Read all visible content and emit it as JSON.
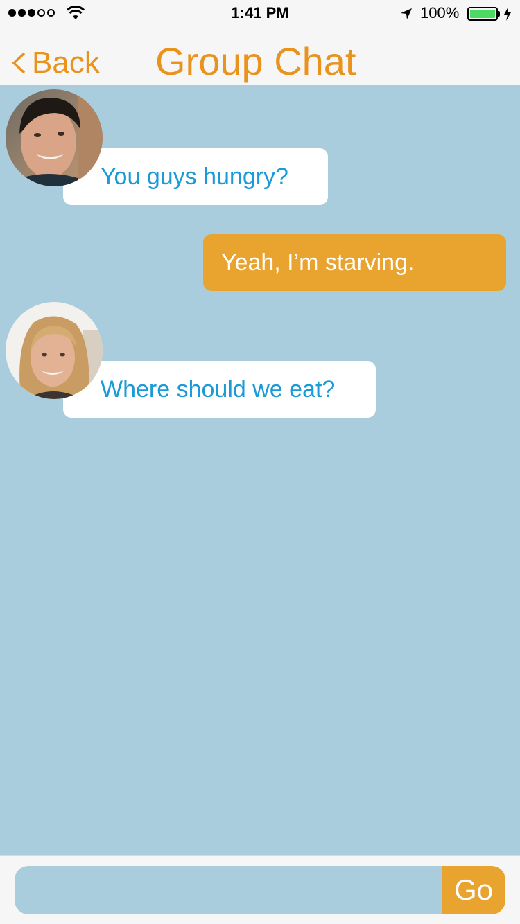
{
  "status_bar": {
    "time": "1:41 PM",
    "battery_percent": "100%",
    "signal_bars": 3,
    "signal_total": 5,
    "icons": [
      "signal-dots-icon",
      "wifi-icon",
      "location-arrow-icon",
      "battery-icon",
      "charging-bolt-icon"
    ]
  },
  "nav": {
    "back_label": "Back",
    "back_icon": "chevron-left-icon",
    "title": "Group Chat"
  },
  "messages": [
    {
      "direction": "incoming",
      "sender_avatar": "avatar-boy",
      "text": "You guys hungry?"
    },
    {
      "direction": "outgoing",
      "text": "Yeah, I’m starving."
    },
    {
      "direction": "incoming",
      "sender_avatar": "avatar-girl",
      "text": "Where should we eat?"
    }
  ],
  "composer": {
    "value": "",
    "placeholder": "",
    "send_label": "Go"
  },
  "colors": {
    "accent": "#e9931d",
    "outgoing_bubble": "#e9a32f",
    "incoming_text": "#1a9ad6",
    "chat_background": "#a9cddc",
    "battery_fill": "#4cd964"
  }
}
